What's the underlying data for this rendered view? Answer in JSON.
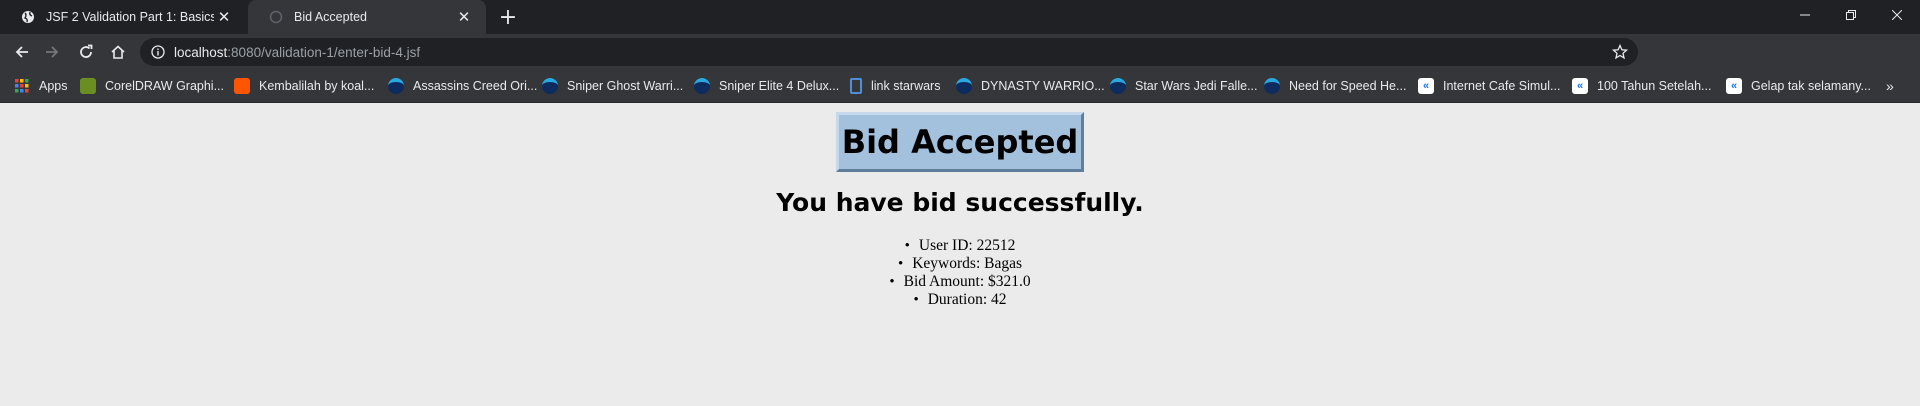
{
  "browser": {
    "tabs": [
      {
        "title": "JSF 2 Validation Part 1: Basics",
        "active": false,
        "favicon": "globe-icon"
      },
      {
        "title": "Bid Accepted",
        "active": true,
        "favicon": "loading-icon"
      }
    ],
    "url_host": "localhost",
    "url_rest": ":8080/validation-1/enter-bid-4.jsf",
    "bookmarks": [
      {
        "label": "Apps",
        "icon": "apps-grid-icon"
      },
      {
        "label": "CorelDRAW Graphi...",
        "icon": "coreldraw-icon"
      },
      {
        "label": "Kembalilah by koal...",
        "icon": "soundcloud-icon"
      },
      {
        "label": "Assassins Creed Ori...",
        "icon": "ninja-icon"
      },
      {
        "label": "Sniper Ghost Warri...",
        "icon": "ninja-icon"
      },
      {
        "label": "Sniper Elite 4 Delux...",
        "icon": "ninja-icon"
      },
      {
        "label": "link starwars",
        "icon": "bookmark-icon"
      },
      {
        "label": "DYNASTY WARRIO...",
        "icon": "ninja-icon"
      },
      {
        "label": "Star Wars Jedi Falle...",
        "icon": "ninja-icon"
      },
      {
        "label": "Need for Speed He...",
        "icon": "ninja-icon"
      },
      {
        "label": "Internet Cafe Simul...",
        "icon": "k-icon"
      },
      {
        "label": "100 Tahun Setelah...",
        "icon": "k-icon"
      },
      {
        "label": "Gelap tak selamany...",
        "icon": "k-icon"
      }
    ],
    "bookmarks_more": "»"
  },
  "page": {
    "heading": "Bid Accepted",
    "subtitle": "You have bid successfully.",
    "details": [
      "User ID: 22512",
      "Keywords: Bagas",
      "Bid Amount: $321.0",
      "Duration: 42"
    ]
  },
  "colors": {
    "tabstrip": "#202124",
    "toolbar": "#35363a",
    "page_background": "#ebebeb",
    "banner_background": "#a3c0dc"
  }
}
